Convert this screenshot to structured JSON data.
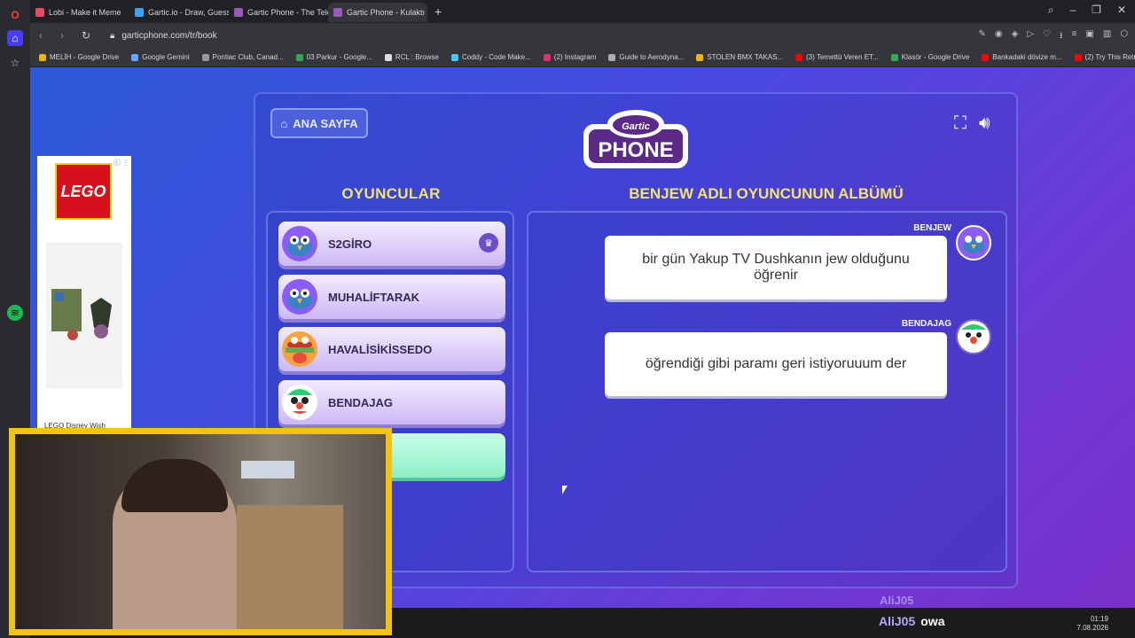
{
  "browser": {
    "tabs": [
      {
        "label": "Lobi - Make it Meme",
        "active": false,
        "color": "#e84a5f"
      },
      {
        "label": "Gartic.io - Draw, Guess, W",
        "active": false,
        "color": "#3ba3ff"
      },
      {
        "label": "Gartic Phone - The Teleph",
        "active": false,
        "color": "#9b59b6"
      },
      {
        "label": "Gartic Phone - Kulaktı",
        "active": true,
        "color": "#9b59b6"
      }
    ],
    "url": "garticphone.com/tr/book",
    "bookmarks": [
      "MELİH - Google Drive",
      "Google Gemini",
      "Pontiac Club, Canad...",
      "03 Parkur - Google...",
      "RCL : Browse",
      "Coddy - Code Make...",
      "(2) Instagram",
      "Guide to Aerodyna...",
      "STOLEN BMX TAKAS...",
      "(3) Temettü Veren ET...",
      "Klasör - Google Drive",
      "Bankadaki dövize m...",
      "(2) Try This Retro Eff..."
    ]
  },
  "game": {
    "home_label": "ANA SAYFA",
    "logo_top": "Gartic",
    "logo_bottom": "PHONE",
    "players_heading": "OYUNCULAR",
    "album_heading": "BENJEW ADLI OYUNCUNUN ALBÜMÜ",
    "players": [
      {
        "name": "S2GİRO",
        "host": true
      },
      {
        "name": "MUHALİFTARAK",
        "host": false
      },
      {
        "name": "HAVALİSİKİSSEDO",
        "host": false
      },
      {
        "name": "BENDAJAG",
        "host": false
      }
    ],
    "album": [
      {
        "author": "BENJEW",
        "text": "bir gün Yakup TV Dushkanın jew olduğunu öğrenir"
      },
      {
        "author": "BENDAJAG",
        "text": "öğrendiği gibi paramı geri istiyoruuum der"
      }
    ]
  },
  "ad": {
    "brand": "LEGO",
    "caption": "LEGO Disney Wish"
  },
  "stream": {
    "chat_faded_user": "AliJ05",
    "chat_user": "AliJ05",
    "chat_message": "owa",
    "time": "01:19",
    "date": "7.08.2026"
  }
}
